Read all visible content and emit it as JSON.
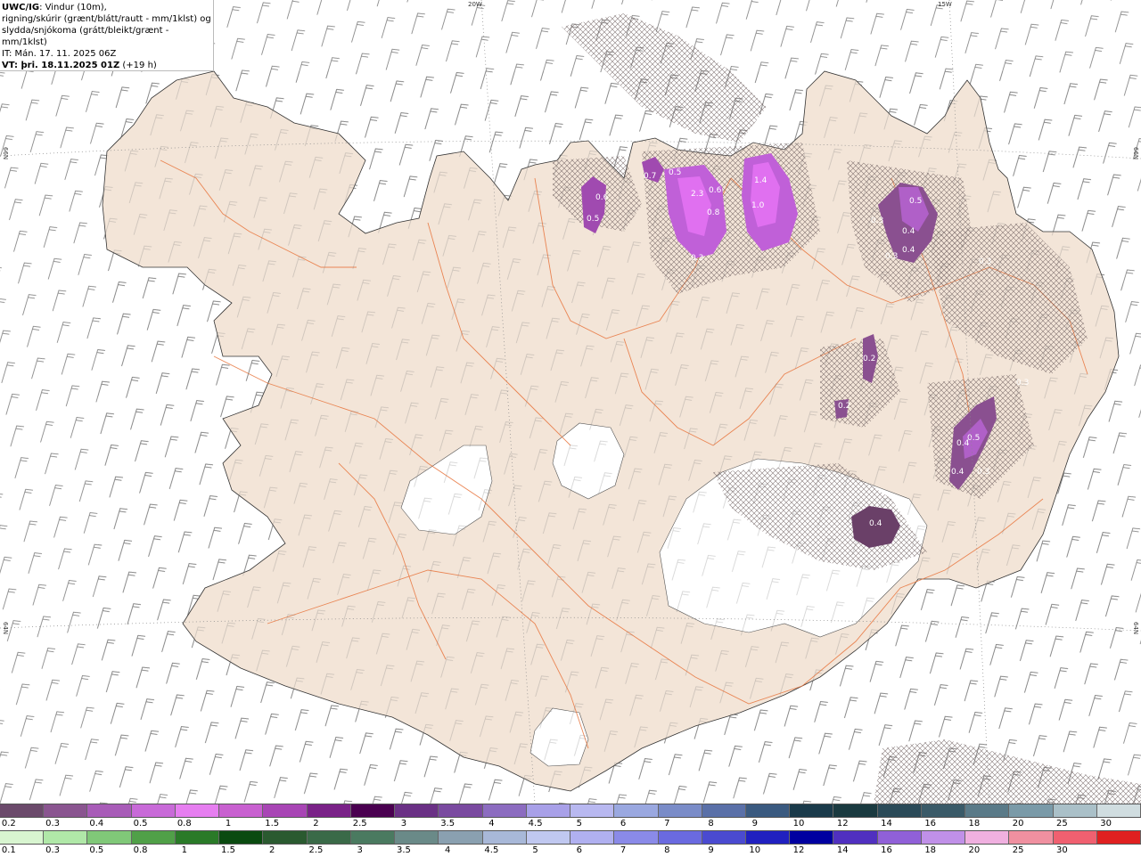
{
  "header": {
    "model": "UWC/IG",
    "title_rest": ": Vindur (10m),",
    "line2": "rigning/skúrir (grænt/blátt/rautt - mm/1klst) og",
    "line3": "slydda/snjókoma (grátt/bleikt/grænt - mm/1klst)",
    "line4": "IT: Mán. 17. 11. 2025 06Z",
    "vt_prefix": "VT: ",
    "vt_value": "þri. 18.11.2025 01Z",
    "vt_suffix": " (+19 h)"
  },
  "grid_labels": {
    "top_20w": "20W",
    "top_15w": "15W",
    "left_66n": "66N",
    "right_66n": "66N",
    "left_64n": "64N",
    "right_64n": "64N"
  },
  "map_values": [
    "0.6",
    "0.5",
    "0.7",
    "0.5",
    "2.3",
    "0.6",
    "0.8",
    "0.3",
    "1.4",
    "1.0",
    "0.5",
    "0.3",
    "0.4",
    "0.4",
    "0.3",
    "0.3",
    "0.2",
    "0.2",
    "0.3",
    "0.4",
    "0.5",
    "0.4",
    "0.3",
    "0.4"
  ],
  "scale_snow": {
    "labels": [
      "0.2",
      "0.3",
      "0.4",
      "0.5",
      "0.8",
      "1",
      "1.5",
      "2",
      "2.5",
      "3",
      "3.5",
      "4",
      "4.5",
      "5",
      "6",
      "7",
      "8",
      "9",
      "10",
      "12",
      "14",
      "16",
      "18",
      "20",
      "25",
      "30"
    ],
    "colors": [
      "#6b4a6b",
      "#8a5590",
      "#a85cb8",
      "#c86ad8",
      "#e67ef0",
      "#c860d0",
      "#a845b5",
      "#7a2288",
      "#4a0050",
      "#6a3085",
      "#7a4aa0",
      "#8c6cc0",
      "#a8a0e8",
      "#b8b8f0",
      "#9aa8e0",
      "#7a8cc8",
      "#5a70a8",
      "#3a5a80",
      "#1a3a4a",
      "#1a3a40",
      "#2a4a58",
      "#3a5a68",
      "#5a7a88",
      "#7a9aa8",
      "#aac0c8",
      "#d0dde0"
    ]
  },
  "scale_rain": {
    "labels": [
      "0.1",
      "0.3",
      "0.5",
      "0.8",
      "1",
      "1.5",
      "2",
      "2.5",
      "3",
      "3.5",
      "4",
      "4.5",
      "5",
      "6",
      "7",
      "8",
      "9",
      "10",
      "12",
      "14",
      "16",
      "18",
      "20",
      "25",
      "30"
    ],
    "colors": [
      "#d8f5d0",
      "#b0e8a8",
      "#80c878",
      "#50a048",
      "#2a7a28",
      "#0a4a10",
      "#2a5a30",
      "#3a6a48",
      "#4a7a60",
      "#6a8a88",
      "#8aa0b0",
      "#a8b8d8",
      "#c0c8f0",
      "#b0b0f0",
      "#8a8ae8",
      "#6a6ae0",
      "#4a4ad0",
      "#2020c0",
      "#0000a0",
      "#5030c0",
      "#9060d8",
      "#c090e8",
      "#f0b0e0",
      "#f090a0",
      "#f06070",
      "#e02020"
    ]
  }
}
